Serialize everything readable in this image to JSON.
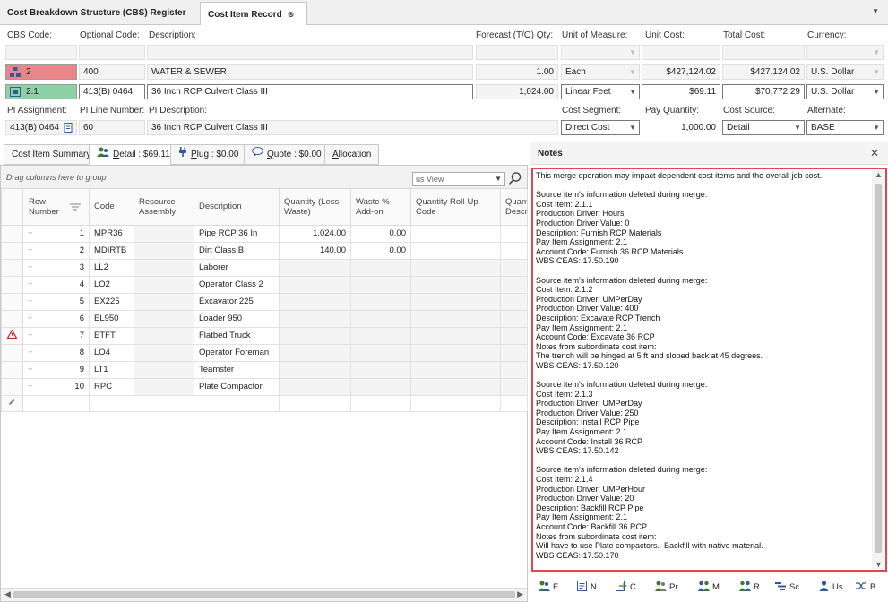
{
  "doc_tabs": [
    {
      "label": "Cost Breakdown Structure (CBS) Register"
    },
    {
      "label": "Cost Item Record",
      "close": "⊗"
    }
  ],
  "header": {
    "labels": {
      "cbs_code": "CBS Code:",
      "optional_code": "Optional Code:",
      "description": "Description:",
      "forecast_qty": "Forecast (T/O) Qty:",
      "uom": "Unit of Measure:",
      "unit_cost": "Unit Cost:",
      "total_cost": "Total Cost:",
      "currency": "Currency:",
      "pi_assignment": "PI Assignment:",
      "pi_line_number": "PI Line Number:",
      "pi_description": "PI Description:",
      "cost_segment": "Cost Segment:",
      "pay_quantity": "Pay Quantity:",
      "cost_source": "Cost Source:",
      "alternate": "Alternate:"
    },
    "row_parent": {
      "cbs_code": "2",
      "optional_code": "400",
      "description": "WATER & SEWER",
      "forecast_qty": "1.00",
      "uom": "Each",
      "unit_cost": "$427,124.02",
      "total_cost": "$427,124.02",
      "currency": "U.S. Dollar"
    },
    "row_current": {
      "cbs_code": "2.1",
      "optional_code": "413(B) 0464",
      "description": "36 Inch RCP Culvert Class III",
      "forecast_qty": "1,024.00",
      "uom": "Linear Feet",
      "unit_cost": "$69.11",
      "total_cost": "$70,772.29",
      "currency": "U.S. Dollar"
    },
    "pi_row": {
      "pi_assignment": "413(B) 0464",
      "pi_line_number": "60",
      "pi_description": "36 Inch RCP Culvert Class III",
      "cost_segment": "Direct Cost",
      "pay_quantity": "1,000.00",
      "cost_source": "Detail",
      "alternate": "BASE"
    },
    "colors": {
      "parent_chip": "#e8868a",
      "current_chip": "#8fd1a6"
    }
  },
  "sub_tabs": [
    {
      "label": "Cost Item Summary"
    },
    {
      "label": "Detail : $69.11",
      "accel": "D",
      "rest": "etail : $69.11"
    },
    {
      "label": "Plug : $0.00",
      "accel": "P",
      "rest": "lug : $0.00"
    },
    {
      "label": "Quote : $0.00",
      "accel": "Q",
      "rest": "uote : $0.00"
    },
    {
      "label": "Allocation",
      "accel": "A",
      "rest": "llocation"
    }
  ],
  "grid": {
    "group_hint": "Drag columns here to group",
    "view_select": "us View",
    "columns": [
      "Row Number",
      "Code",
      "Resource Assembly",
      "Description",
      "Quantity (Less Waste)",
      "Waste % Add-on",
      "Quantity Roll-Up Code",
      "Quantity Description"
    ],
    "rows": [
      {
        "n": "1",
        "code": "MPR36",
        "desc": "Pipe RCP 36 In",
        "qty": "1,024.00",
        "waste": "0.00"
      },
      {
        "n": "2",
        "code": "MDIRTB",
        "desc": "Dirt Class B",
        "qty": "140.00",
        "waste": "0.00"
      },
      {
        "n": "3",
        "code": "LL2",
        "desc": "Laborer",
        "qty": "",
        "waste": ""
      },
      {
        "n": "4",
        "code": "LO2",
        "desc": "Operator Class 2",
        "qty": "",
        "waste": ""
      },
      {
        "n": "5",
        "code": "EX225",
        "desc": "Excavator 225",
        "qty": "",
        "waste": ""
      },
      {
        "n": "6",
        "code": "EL950",
        "desc": "Loader 950",
        "qty": "",
        "waste": ""
      },
      {
        "n": "7",
        "code": "ETFT",
        "desc": "Flatbed Truck",
        "qty": "",
        "waste": ""
      },
      {
        "n": "8",
        "code": "LO4",
        "desc": "Operator Foreman",
        "qty": "",
        "waste": ""
      },
      {
        "n": "9",
        "code": "LT1",
        "desc": "Teamster",
        "qty": "",
        "waste": ""
      },
      {
        "n": "10",
        "code": "RPC",
        "desc": "Plate Compactor",
        "qty": "",
        "waste": ""
      }
    ]
  },
  "notes": {
    "title": "Notes",
    "close": "✕",
    "text": "This merge operation may impact dependent cost items and the overall job cost.\n\nSource item's information deleted during merge:\nCost Item: 2.1.1\nProduction Driver: Hours\nProduction Driver Value: 0\nDescription: Furnish RCP Materials\nPay Item Assignment: 2.1\nAccount Code: Furnish 36 RCP Materials\nWBS CEAS: 17.50.190\n\nSource item's information deleted during merge:\nCost Item: 2.1.2\nProduction Driver: UMPerDay\nProduction Driver Value: 400\nDescription: Excavate RCP Trench\nPay Item Assignment: 2.1\nAccount Code: Excavate 36 RCP\nNotes from subordinate cost item:\nThe trench will be hinged at 5 ft and sloped back at 45 degrees.\nWBS CEAS: 17.50.120\n\nSource item's information deleted during merge:\nCost Item: 2.1.3\nProduction Driver: UMPerDay\nProduction Driver Value: 250\nDescription: Install RCP Pipe\nPay Item Assignment: 2.1\nAccount Code: Install 36 RCP\nWBS CEAS: 17.50.142\n\nSource item's information deleted during merge:\nCost Item: 2.1.4\nProduction Driver: UMPerHour\nProduction Driver Value: 20\nDescription: Backfill RCP Pipe\nPay Item Assignment: 2.1\nAccount Code: Backfill 36 RCP\nNotes from subordinate cost item:\nWill have to use Plate compactors.  Backfill with native material.\nWBS CEAS: 17.50.170"
  },
  "bottom_tabs": [
    "E...",
    "N...",
    "C...",
    "Pr...",
    "M...",
    "R...",
    "Sc...",
    "Us...",
    "B..."
  ]
}
